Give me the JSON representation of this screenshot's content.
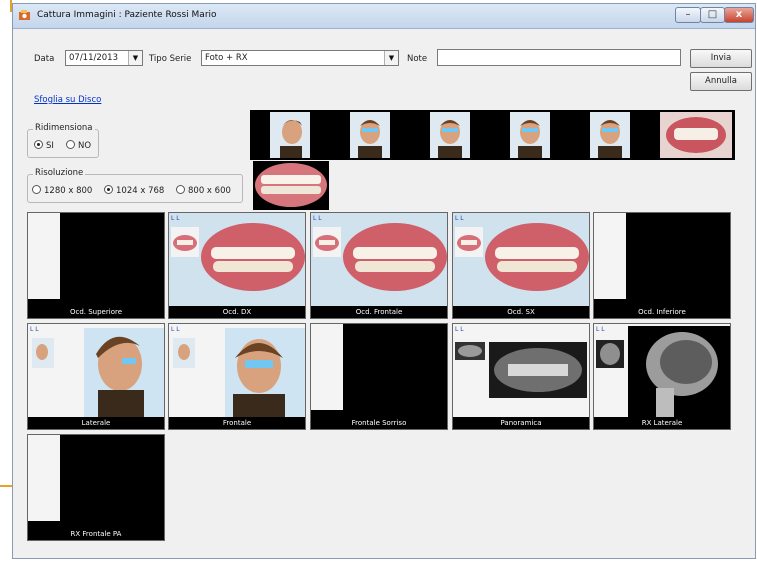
{
  "window": {
    "title": "Cattura Immagini : Paziente Rossi Mario",
    "min": "–",
    "max": "□",
    "close": "x"
  },
  "form": {
    "data_label": "Data",
    "data_value": "07/11/2013",
    "tipo_serie_label": "Tipo Serie",
    "tipo_serie_value": "Foto + RX",
    "note_label": "Note",
    "note_value": "",
    "invia": "Invia",
    "annulla": "Annulla",
    "sfoglia": "Sfoglia su Disco"
  },
  "ridimensiona": {
    "title": "Ridimensiona",
    "options": [
      {
        "label": "SI",
        "selected": true
      },
      {
        "label": "NO",
        "selected": false
      }
    ]
  },
  "risoluzione": {
    "title": "Risoluzione",
    "options": [
      {
        "label": "1280 x 800",
        "selected": false
      },
      {
        "label": "1024 x 768",
        "selected": true
      },
      {
        "label": "800 x 600",
        "selected": false
      }
    ]
  },
  "tiles": [
    {
      "caption": "Ocd. Superiore",
      "kind": "empty"
    },
    {
      "caption": "Ocd. DX",
      "kind": "teeth"
    },
    {
      "caption": "Ocd. Frontale",
      "kind": "teeth"
    },
    {
      "caption": "Ocd. SX",
      "kind": "teeth"
    },
    {
      "caption": "Ocd. Inferiore",
      "kind": "empty"
    },
    {
      "caption": "Laterale",
      "kind": "profile"
    },
    {
      "caption": "Frontale",
      "kind": "face"
    },
    {
      "caption": "Frontale Sorriso",
      "kind": "empty"
    },
    {
      "caption": "Panoramica",
      "kind": "xray-pano"
    },
    {
      "caption": "RX Laterale",
      "kind": "xray-lat"
    },
    {
      "caption": "RX Frontale PA",
      "kind": "empty"
    }
  ],
  "tile_mini_label": "L  L",
  "colors": {
    "accent": "#e8a22c",
    "link": "#0033cc",
    "tile_bg": "#000000"
  }
}
